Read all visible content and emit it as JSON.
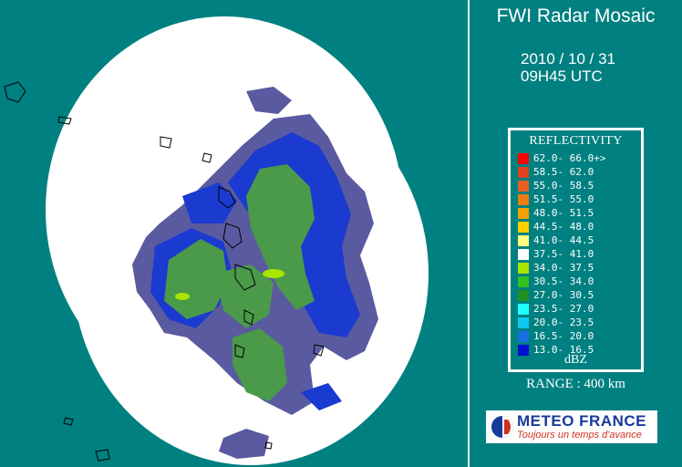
{
  "title": "FWI Radar Mosaic",
  "date": "2010 / 10 / 31",
  "time": "09H45 UTC",
  "legend": {
    "title": "REFLECTIVITY",
    "unit": "dBZ",
    "entries": [
      {
        "label": "62.0- 66.0+>",
        "color": "#ff0000"
      },
      {
        "label": "58.5- 62.0",
        "color": "#e0401a"
      },
      {
        "label": "55.0- 58.5",
        "color": "#e86020"
      },
      {
        "label": "51.5- 55.0",
        "color": "#f07c10"
      },
      {
        "label": "48.0- 51.5",
        "color": "#f4a000"
      },
      {
        "label": "44.5- 48.0",
        "color": "#ffd000"
      },
      {
        "label": "41.0- 44.5",
        "color": "#ffff80"
      },
      {
        "label": "37.5- 41.0",
        "color": "#ffffff"
      },
      {
        "label": "34.0- 37.5",
        "color": "#a8e600"
      },
      {
        "label": "30.5- 34.0",
        "color": "#30c020"
      },
      {
        "label": "27.0- 30.5",
        "color": "#209020"
      },
      {
        "label": "23.5- 27.0",
        "color": "#20ffff"
      },
      {
        "label": "20.0- 23.5",
        "color": "#10c8f0"
      },
      {
        "label": "16.5- 20.0",
        "color": "#1870e0"
      },
      {
        "label": "13.0- 16.5",
        "color": "#0010d0"
      }
    ]
  },
  "range_label": "RANGE : 400 km",
  "logo": {
    "name": "METEO FRANCE",
    "tagline": "Toujours un temps d'avance"
  },
  "colors": {
    "background": "#008080",
    "coverage": "#ffffff",
    "echo_low": "#5a5aa0",
    "echo_blue": "#1a3ad0",
    "echo_green": "#4a9a4a"
  }
}
